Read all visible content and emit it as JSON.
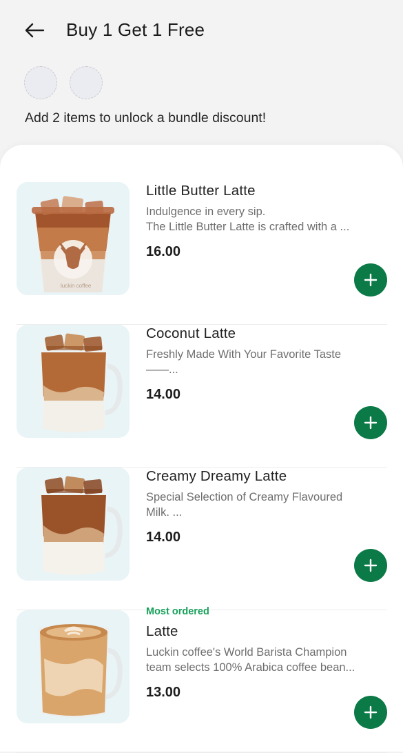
{
  "header": {
    "title": "Buy 1 Get 1 Free"
  },
  "bundle": {
    "slots": 2,
    "hint": "Add 2 items to unlock a bundle discount!"
  },
  "colors": {
    "accent": "#0b7a47",
    "badge": "#17a05a",
    "thumb_bg": "#e8f4f6"
  },
  "products": [
    {
      "name": "Little Butter Latte",
      "desc_line1": "Indulgence in every sip.",
      "desc_line2": "The Little Butter Latte is crafted with a ...",
      "price": "16.00",
      "image": "iced-butter-latte-cup",
      "cup_logo": "luckin coffee"
    },
    {
      "name": "Coconut Latte",
      "desc_line1": "Freshly Made With Your Favorite Taste",
      "desc_line2": "——...",
      "price": "14.00",
      "image": "iced-coconut-latte-mug"
    },
    {
      "name": "Creamy Dreamy Latte",
      "desc_line1": "Special Selection of Creamy Flavoured",
      "desc_line2": "Milk. ...",
      "price": "14.00",
      "image": "iced-creamy-latte-mug"
    },
    {
      "badge": "Most ordered",
      "name": "Latte",
      "desc_line1": "Luckin coffee's World Barista Champion",
      "desc_line2": "team selects 100% Arabica coffee bean...",
      "price": "13.00",
      "image": "hot-latte-mug"
    }
  ]
}
